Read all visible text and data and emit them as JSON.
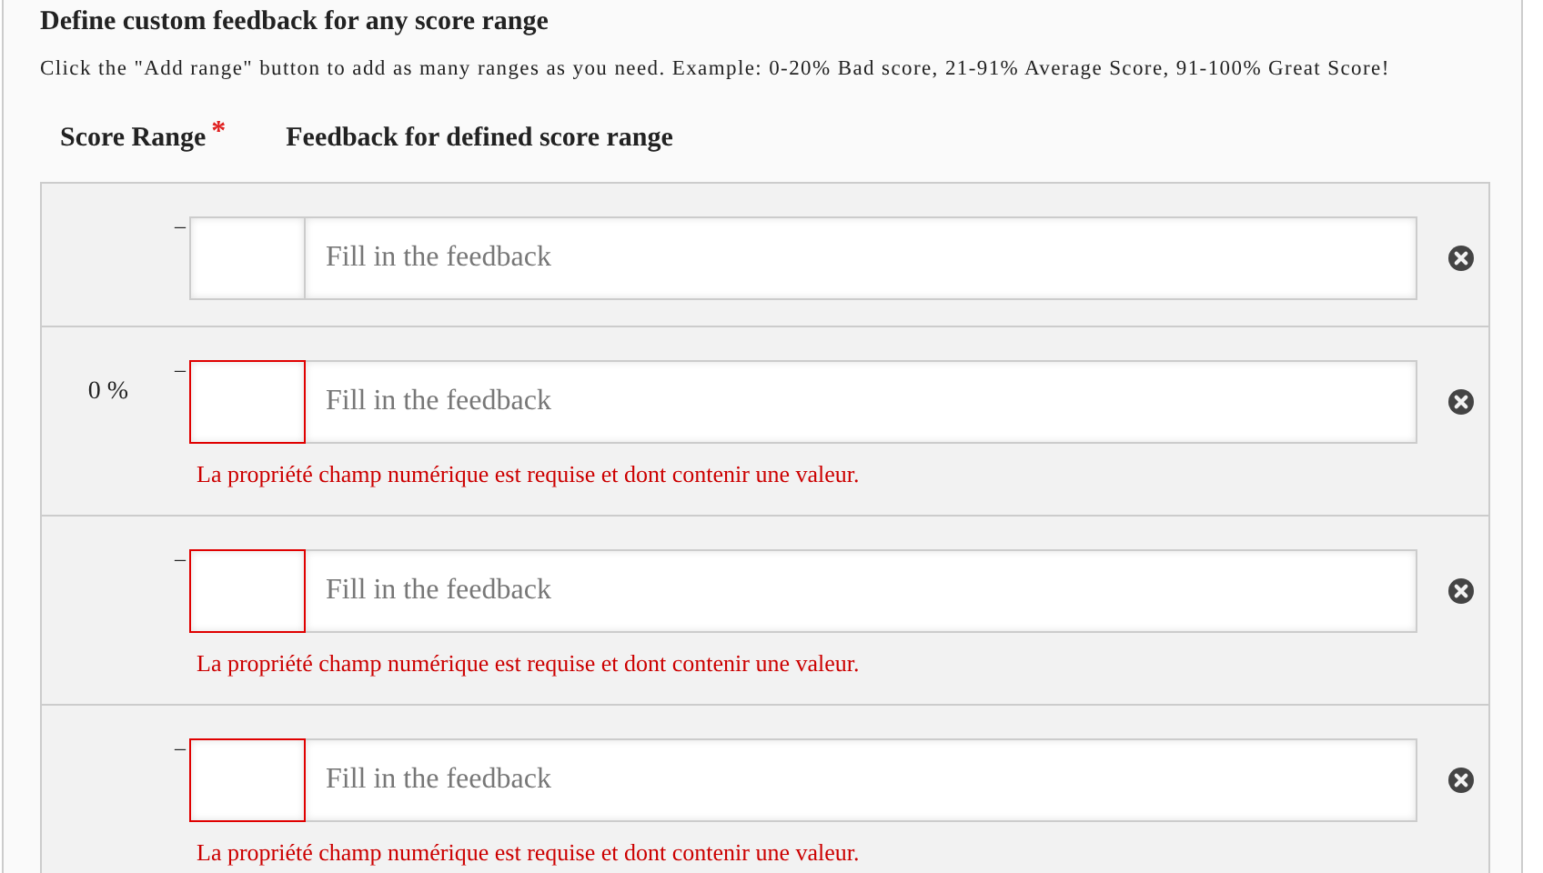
{
  "title": "Define custom feedback for any score range",
  "description": "Click the \"Add range\" button to add as many ranges as you need. Example: 0-20% Bad score, 21-91% Average Score, 91-100% Great Score!",
  "columns": {
    "score_range": "Score Range",
    "required_mark": "*",
    "feedback": "Feedback for defined score range"
  },
  "rows": [
    {
      "start": "",
      "dash": "–",
      "invalid": false,
      "feedback_placeholder": "Fill in the feedback"
    },
    {
      "start": "0 %",
      "dash": "–",
      "invalid": true,
      "feedback_placeholder": "Fill in the feedback",
      "error": "La propriété champ numérique est requise et dont contenir une valeur."
    },
    {
      "start": "",
      "dash": "–",
      "invalid": true,
      "feedback_placeholder": "Fill in the feedback",
      "error": "La propriété champ numérique est requise et dont contenir une valeur."
    },
    {
      "start": "",
      "dash": "–",
      "invalid": true,
      "feedback_placeholder": "Fill in the feedback",
      "error": "La propriété champ numérique est requise et dont contenir une valeur."
    }
  ]
}
